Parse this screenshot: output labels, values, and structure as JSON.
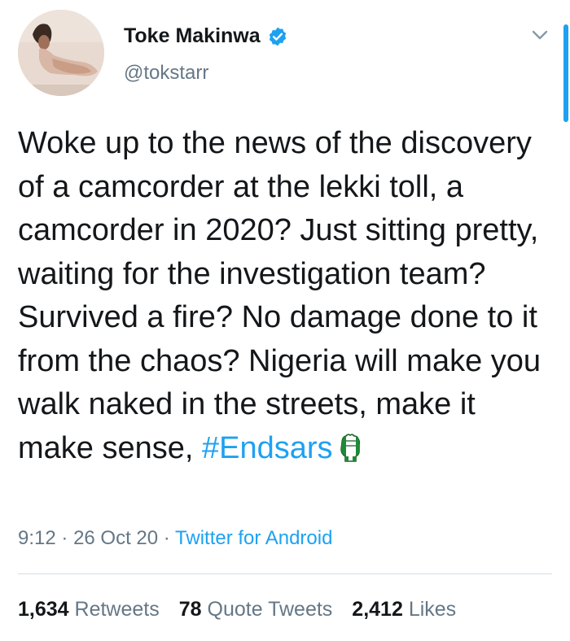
{
  "author": {
    "display_name": "Toke Makinwa",
    "handle": "@tokstarr",
    "verified": true
  },
  "tweet": {
    "text_plain": "Woke up to the news of the discovery of a camcorder at the lekki toll, a camcorder in 2020? Just sitting pretty, waiting for the investigation team? Survived a fire? No damage done to it from the chaos? Nigeria will make you walk naked in the streets, make it make sense,",
    "hashtag": "#Endsars",
    "emoji": "raised-fist-nigeria-flag-icon"
  },
  "meta": {
    "time": "9:12",
    "date": "26 Oct 20",
    "source": "Twitter for Android",
    "separator": "·"
  },
  "stats": {
    "retweets_count": "1,634",
    "retweets_label": "Retweets",
    "quotes_count": "78",
    "quotes_label": "Quote Tweets",
    "likes_count": "2,412",
    "likes_label": "Likes"
  },
  "colors": {
    "accent": "#1da1f2",
    "text": "#14171a",
    "muted": "#657786",
    "divider": "#d6dde3"
  }
}
